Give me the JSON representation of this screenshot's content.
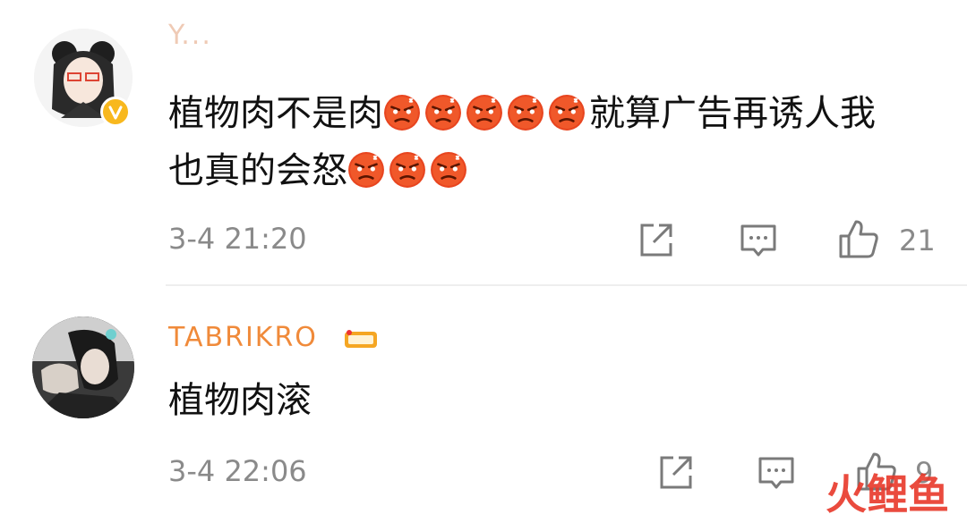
{
  "comments": [
    {
      "username": "Y...",
      "text_line1": "植物肉不是肉",
      "text_line1_after": "就算广告再诱人我",
      "text_line2": "也真的会怒",
      "timestamp": "3-4 21:20",
      "like_count": "21"
    },
    {
      "username": "TABRIKRO",
      "text": "植物肉滚",
      "timestamp": "3-4 22:06",
      "like_count": "9"
    }
  ],
  "watermark": "火鲤鱼",
  "colors": {
    "username_orange": "#f08a3a",
    "verified_badge": "#f8b81e",
    "meta_gray": "#8a8a8a",
    "watermark": "#e8382a"
  },
  "icons": [
    "share-icon",
    "comment-icon",
    "like-icon",
    "angry-emoji-icon",
    "verified-badge-icon",
    "vip-badge-icon"
  ]
}
